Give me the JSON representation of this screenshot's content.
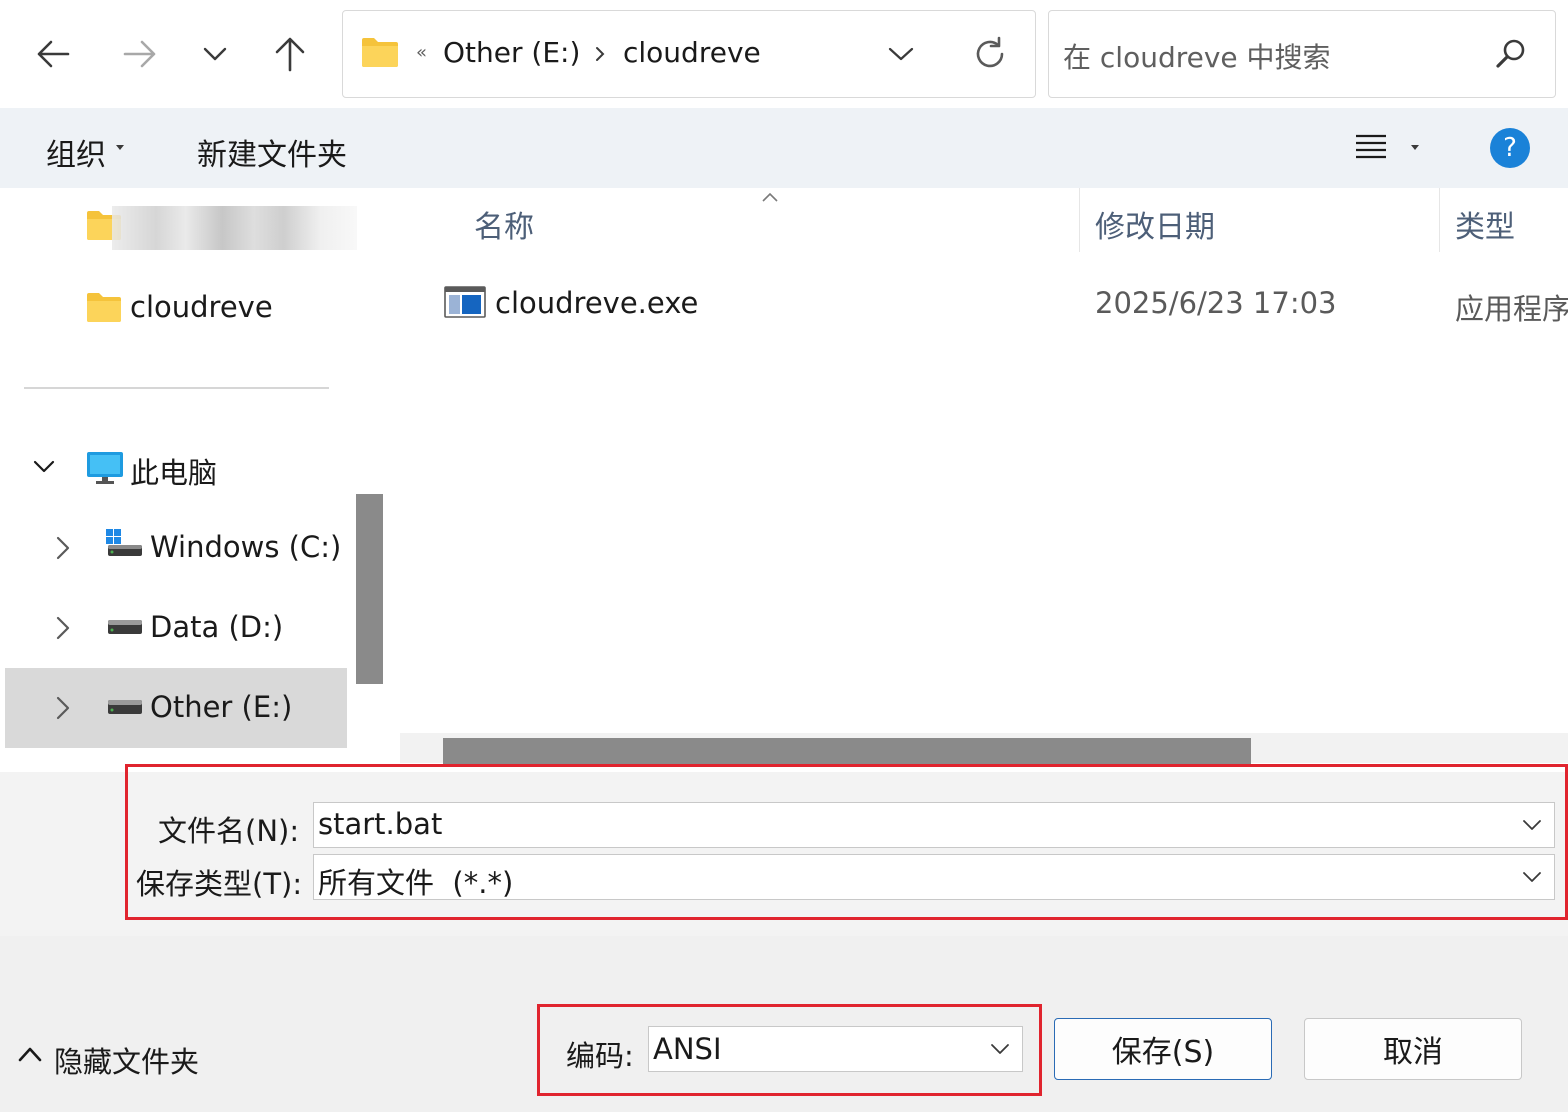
{
  "nav": {
    "back_icon": "arrow-left-icon",
    "forward_icon": "arrow-right-icon",
    "recent_icon": "chevron-down-icon",
    "up_icon": "arrow-up-icon"
  },
  "address": {
    "overflow": "«",
    "crumbs": [
      "Other (E:)",
      "cloudreve"
    ]
  },
  "search": {
    "placeholder": "在 cloudreve 中搜索"
  },
  "toolbar": {
    "organize": "组织",
    "new_folder": "新建文件夹",
    "help": "?"
  },
  "tree": {
    "items": [
      {
        "label": ""
      },
      {
        "label": "cloudreve"
      },
      {
        "label": "此电脑"
      },
      {
        "label": "Windows (C:)"
      },
      {
        "label": "Data (D:)"
      },
      {
        "label": "Other (E:)"
      }
    ]
  },
  "filelist": {
    "columns": [
      "名称",
      "修改日期",
      "类型"
    ],
    "rows": [
      {
        "name": "cloudreve.exe",
        "date": "2025/6/23 17:03",
        "type": "应用程序"
      }
    ]
  },
  "save": {
    "filename_label": "文件名(N):",
    "filename_value": "start.bat",
    "filetype_label": "保存类型(T):",
    "filetype_value": "所有文件  (*.*)",
    "encoding_label": "编码:",
    "encoding_value": "ANSI",
    "hide_folders": "隐藏文件夹",
    "save_button": "保存(S)",
    "cancel_button": "取消"
  },
  "colors": {
    "highlight_red": "#e0242e",
    "primary_border": "#2a6bb5",
    "help_blue": "#1a82d8"
  }
}
